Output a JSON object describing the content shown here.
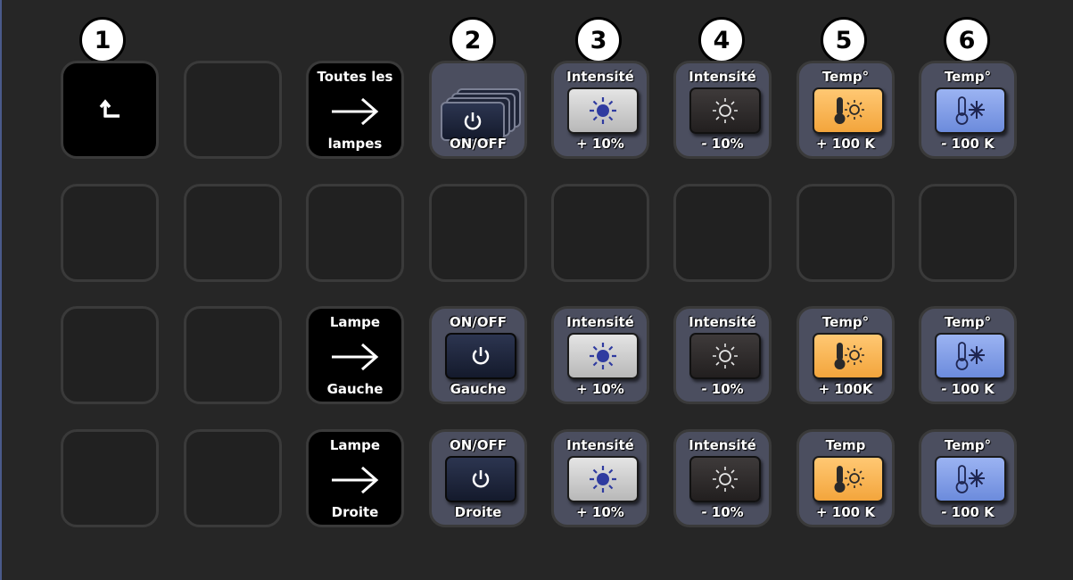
{
  "badges": [
    "1",
    "2",
    "3",
    "4",
    "5",
    "6"
  ],
  "row1": {
    "all_lamps": {
      "top": "Toutes les",
      "bottom": "lampes"
    },
    "onoff": {
      "bottom": "ON/OFF"
    },
    "int_plus": {
      "top": "Intensité",
      "bottom": "+ 10%"
    },
    "int_minus": {
      "top": "Intensité",
      "bottom": "- 10%"
    },
    "temp_plus": {
      "top": "Temp°",
      "bottom": "+ 100 K"
    },
    "temp_minus": {
      "top": "Temp°",
      "bottom": "- 100 K"
    }
  },
  "row3": {
    "lamp": {
      "top": "Lampe",
      "bottom": "Gauche"
    },
    "onoff": {
      "top": "ON/OFF",
      "bottom": "Gauche"
    },
    "int_plus": {
      "top": "Intensité",
      "bottom": "+ 10%"
    },
    "int_minus": {
      "top": "Intensité",
      "bottom": "- 10%"
    },
    "temp_plus": {
      "top": "Temp°",
      "bottom": "+ 100K"
    },
    "temp_minus": {
      "top": "Temp°",
      "bottom": "- 100 K"
    }
  },
  "row4": {
    "lamp": {
      "top": "Lampe",
      "bottom": "Droite"
    },
    "onoff": {
      "top": "ON/OFF",
      "bottom": "Droite"
    },
    "int_plus": {
      "top": "Intensité",
      "bottom": "+ 10%"
    },
    "int_minus": {
      "top": "Intensité",
      "bottom": "- 10%"
    },
    "temp_plus": {
      "top": "Temp",
      "bottom": "+ 100 K"
    },
    "temp_minus": {
      "top": "Temp°",
      "bottom": "- 100 K"
    }
  },
  "icons": {
    "back": "back-arrow-icon",
    "arrow": "right-arrow-icon",
    "power": "power-icon",
    "sun_bright": "sun-filled-icon",
    "sun_dim": "sun-outline-icon",
    "thermo_warm": "thermometer-sun-icon",
    "thermo_cold": "thermometer-snowflake-icon"
  },
  "colors": {
    "background": "#262626",
    "key_frame": "#4b4e5f",
    "warm": "#f3a53c",
    "cold": "#6c8bdc"
  }
}
